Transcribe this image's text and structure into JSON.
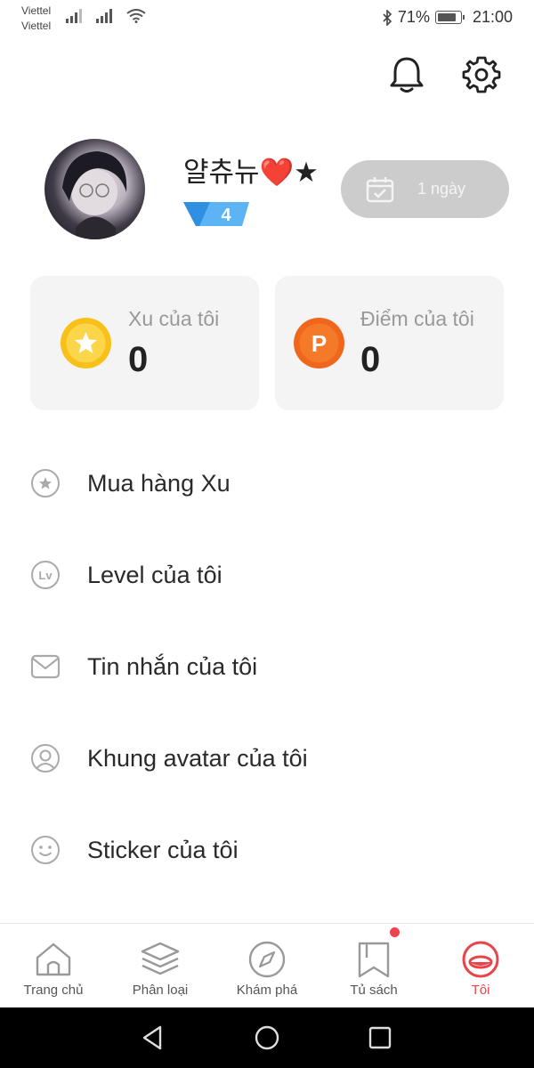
{
  "status_bar": {
    "carrier1": "Viettel",
    "carrier2": "Viettel",
    "battery": "71%",
    "battery_level": 0.71,
    "time": "21:00",
    "icons": [
      "signal-icon",
      "signal-icon",
      "wifi-icon",
      "bluetooth-icon",
      "battery-icon"
    ]
  },
  "header": {
    "icons": [
      "bell-icon",
      "gear-icon"
    ]
  },
  "profile": {
    "username": "얄츄뉴❤️★",
    "level": "4",
    "checkin_label": "1 ngày"
  },
  "cards": {
    "coins": {
      "title": "Xu của tôi",
      "value": "0",
      "icon": "star-coin-icon"
    },
    "points": {
      "title": "Điểm của tôi",
      "value": "0",
      "icon_letter": "P"
    }
  },
  "menu": [
    {
      "label": "Mua hàng Xu",
      "icon": "star-circle-icon"
    },
    {
      "label": "Level của tôi",
      "icon": "lv-icon"
    },
    {
      "label": "Tin nhắn của tôi",
      "icon": "mail-icon"
    },
    {
      "label": "Khung avatar của tôi",
      "icon": "user-circle-icon"
    },
    {
      "label": "Sticker của tôi",
      "icon": "smiley-icon"
    }
  ],
  "menu_lv_text": "Lv",
  "bottom_nav": [
    {
      "label": "Trang chủ",
      "icon": "home-icon"
    },
    {
      "label": "Phân loại",
      "icon": "layers-icon"
    },
    {
      "label": "Khám phá",
      "icon": "compass-icon"
    },
    {
      "label": "Tủ sách",
      "icon": "bookmark-icon"
    },
    {
      "label": "Tôi",
      "icon": "profile-face-icon",
      "active": true
    }
  ],
  "colors": {
    "accent": "#e8444a",
    "coin": "#f7c11a",
    "point": "#f0661d",
    "level_badge": "#3aa0f0"
  }
}
